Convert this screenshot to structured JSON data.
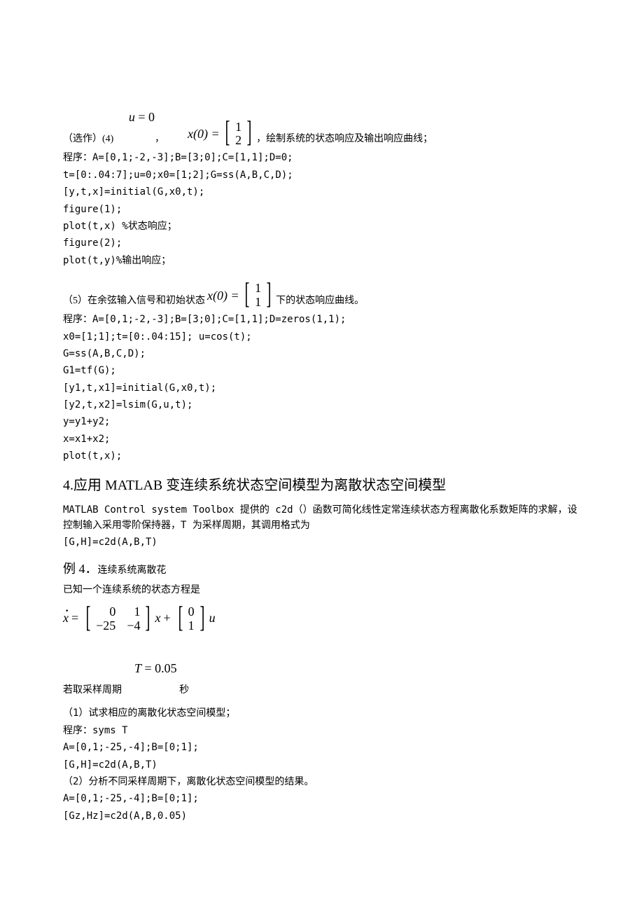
{
  "p1": {
    "prefix": "（选作）(4) ",
    "eq_u": "u",
    "eq_eq": " = ",
    "eq_zero": "0",
    "comma": "，",
    "x0_lhs": "x",
    "x0_paren": "(0) = ",
    "x0_r1": "1",
    "x0_r2": "2",
    "suffix": "，绘制系统的状态响应及输出响应曲线；"
  },
  "code1": [
    "程序：A=[0,1;-2,-3];B=[3;0];C=[1,1];D=0;",
    "t=[0:.04:7];u=0;x0=[1;2];G=ss(A,B,C,D);",
    "[y,t,x]=initial(G,x0,t);",
    "figure(1);",
    "plot(t,x)  %状态响应；",
    "figure(2);",
    "plot(t,y)%输出响应；"
  ],
  "p2": {
    "prefix": "（5）在余弦输入信号和初始状态",
    "x0_lhs": "x",
    "x0_paren": "(0) = ",
    "x0_r1": "1",
    "x0_r2": "1",
    "suffix": "下的状态响应曲线。"
  },
  "code2": [
    "程序：A=[0,1;-2,-3];B=[3;0];C=[1,1];D=zeros(1,1);",
    "x0=[1;1];t=[0:.04:15]; u=cos(t);",
    "G=ss(A,B,C,D);",
    "G1=tf(G);",
    "[y1,t,x1]=initial(G,x0,t);",
    "[y2,t,x2]=lsim(G,u,t);",
    "y=y1+y2;",
    "x=x1+x2;",
    "plot(t,x);"
  ],
  "section4": "4.应用 MATLAB 变连续系统状态空间模型为离散状态空间模型",
  "section4_body": [
    "MATLAB Control system Toolbox 提供的 c2d（）函数可简化线性定常连续状态方程离散化系数矩阵的求解，设控制输入采用零阶保持器，T 为采样周期，其调用格式为",
    "[G,H]=c2d(A,B,T)"
  ],
  "example4": {
    "label": "例 4．",
    "rest": "连续系统离散花"
  },
  "ex4_line1": "已知一个连续系统的状态方程是",
  "matrix_eq": {
    "x": "x",
    "A": [
      [
        "0",
        "1"
      ],
      [
        "−25",
        "−4"
      ]
    ],
    "B": [
      [
        "0"
      ],
      [
        "1"
      ]
    ],
    "u": "u"
  },
  "ex4_line2": {
    "prefix": "若取采样周期",
    "T": "T",
    "eq": " = ",
    "val": "0.05",
    "suffix": " 秒"
  },
  "code3": [
    "（1）试求相应的离散化状态空间模型；",
    "程序：syms T",
    "A=[0,1;-25,-4];B=[0;1];",
    " [G,H]=c2d(A,B,T)",
    "（2）分析不同采样周期下，离散化状态空间模型的结果。",
    "A=[0,1;-25,-4];B=[0;1];",
    " [Gz,Hz]=c2d(A,B,0.05)"
  ]
}
